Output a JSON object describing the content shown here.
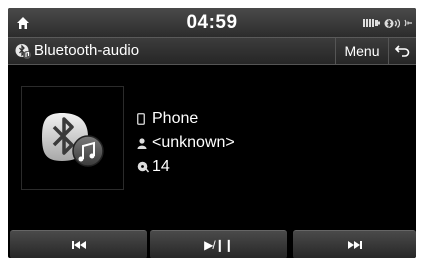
{
  "status_bar": {
    "clock": "04:59"
  },
  "title_bar": {
    "title": "Bluetooth-audio",
    "menu_label": "Menu"
  },
  "track_info": {
    "device": "Phone",
    "artist": "<unknown>",
    "track_number": "14"
  },
  "controls": {
    "play_pause_label": "▶/❙❙"
  },
  "icons": {
    "home": "home-icon",
    "battery": "battery-icon",
    "bluetooth_audio_status": "bluetooth-audio-status-icon",
    "bluetooth_audio": "bluetooth-audio-icon",
    "back": "back-arrow-icon",
    "phone": "phone-icon",
    "artist": "person-icon",
    "track": "disc-icon",
    "previous": "previous-track-icon",
    "next": "next-track-icon"
  },
  "colors": {
    "background": "#000000",
    "text": "#ffffff",
    "bar": "#3a3a3a"
  }
}
